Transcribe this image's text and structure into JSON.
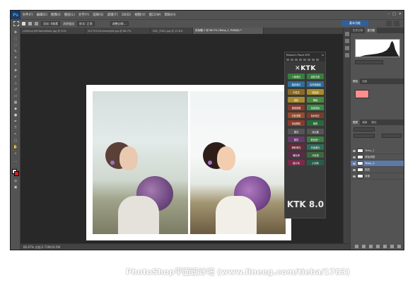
{
  "menubar": {
    "logo": "Ps",
    "items": [
      "文件(F)",
      "编辑(E)",
      "图像(I)",
      "图层(L)",
      "文字(Y)",
      "选择(S)",
      "滤镜(T)",
      "3D(D)",
      "视图(V)",
      "窗口(W)",
      "帮助(H)"
    ]
  },
  "optbar": {
    "feather": "羽化: 0像素",
    "antialias": "消除锯齿",
    "style": "样式: 正常",
    "refine": "调整边缘..."
  },
  "workspace": {
    "label": "基本功能"
  },
  "tabs": [
    {
      "label": "Unifying Nft NameNote.jpg @ 50%"
    },
    {
      "label": "20170101mmweight.jpg @ 66.7%"
    },
    {
      "label": "DSC_5301.jpg @ 15.8%"
    },
    {
      "label": "未标题-1 @ 66.7% (Temp_1, RGB/8) *"
    }
  ],
  "ktk": {
    "title": "Retouch Panel KTK",
    "logo": "✕KTK",
    "footer": "KTK 8.0",
    "buttons": [
      "人像美白",
      "皮肤去斑",
      "磨皮美白",
      "高低频磨皮",
      "中性灰",
      "双曲线",
      "锐化",
      "降噪",
      "通道抠图",
      "加深减淡",
      "光影重塑",
      "色彩校正",
      "添加颗粒",
      "暗角",
      "柔光",
      "对比度",
      "提亮",
      "肤色统一",
      "眼睛明亮",
      "牙齿美白",
      "暖色调",
      "冷色调",
      "胶片风",
      "小清新"
    ]
  },
  "rightpanel": {
    "top_tabs": [
      "历史记录",
      "直方图"
    ],
    "swatch_color": "#fe8d8d",
    "mid_tabs": [
      "颜色",
      "色板"
    ],
    "layer_tabs": [
      "图层",
      "通道",
      "路径"
    ],
    "layers": [
      {
        "name": "Temp_1",
        "selected": false
      },
      {
        "name": "原始调整",
        "selected": false
      },
      {
        "name": "Temp_2",
        "selected": true
      },
      {
        "name": "图层",
        "selected": false
      },
      {
        "name": "背景",
        "selected": false
      }
    ]
  },
  "status": {
    "text": "66.67%   文档:2.71M/10.5M"
  },
  "watermark": {
    "text": "PhotoShop平面设计吧 (www.lineeg.com/tieba/1783)"
  }
}
